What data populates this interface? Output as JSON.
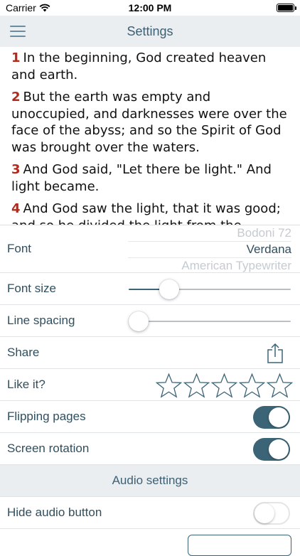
{
  "status_bar": {
    "carrier": "Carrier",
    "time": "12:00 PM"
  },
  "nav": {
    "title": "Settings"
  },
  "reader": {
    "verses": [
      {
        "num": "1",
        "text": "In the beginning, God created heaven and earth."
      },
      {
        "num": "2",
        "text": "But the earth was empty and unoccupied, and darknesses were over the face of the abyss; and so the Spirit of God was brought over the waters."
      },
      {
        "num": "3",
        "text": "And God said, \"Let there be light.\" And light became."
      },
      {
        "num": "4",
        "text": "And God saw the light, that it was good; and so he divided the light from the darkness."
      }
    ]
  },
  "settings": {
    "font": {
      "label": "Font",
      "options": [
        "Bodoni 72",
        "Verdana",
        "American Typewriter"
      ],
      "selected": "Verdana"
    },
    "font_size": {
      "label": "Font size",
      "value": 0.25
    },
    "line_spacing": {
      "label": "Line spacing",
      "value": 0.06
    },
    "share": {
      "label": "Share"
    },
    "like": {
      "label": "Like it?",
      "rating": 0,
      "max": 5
    },
    "flipping_pages": {
      "label": "Flipping pages",
      "on": true
    },
    "screen_rotation": {
      "label": "Screen rotation",
      "on": true
    },
    "audio_header": "Audio settings",
    "hide_audio": {
      "label": "Hide audio button",
      "on": false
    }
  },
  "colors": {
    "accent": "#3b6476",
    "verse_number": "#b22a1c",
    "nav_background": "#ebeef1"
  }
}
